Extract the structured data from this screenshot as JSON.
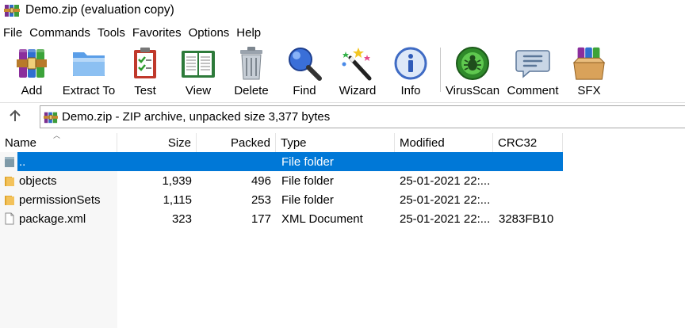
{
  "window": {
    "title": "Demo.zip (evaluation copy)"
  },
  "menu": [
    "File",
    "Commands",
    "Tools",
    "Favorites",
    "Options",
    "Help"
  ],
  "toolbar": [
    {
      "label": "Add",
      "icon": "add-archive-icon"
    },
    {
      "label": "Extract To",
      "icon": "extract-folder-icon"
    },
    {
      "label": "Test",
      "icon": "test-clipboard-icon"
    },
    {
      "label": "View",
      "icon": "view-book-icon"
    },
    {
      "label": "Delete",
      "icon": "trash-icon"
    },
    {
      "label": "Find",
      "icon": "magnifier-icon"
    },
    {
      "label": "Wizard",
      "icon": "magic-wand-icon"
    },
    {
      "label": "Info",
      "icon": "info-icon"
    },
    {
      "label": "VirusScan",
      "icon": "virus-scan-icon"
    },
    {
      "label": "Comment",
      "icon": "comment-icon"
    },
    {
      "label": "SFX",
      "icon": "sfx-box-icon"
    }
  ],
  "address": {
    "text": "Demo.zip - ZIP archive, unpacked size 3,377 bytes"
  },
  "columns": {
    "name": "Name",
    "size": "Size",
    "packed": "Packed",
    "type": "Type",
    "modified": "Modified",
    "crc": "CRC32"
  },
  "files": [
    {
      "name": "..",
      "size": "",
      "packed": "",
      "type": "File folder",
      "modified": "",
      "crc": "",
      "icon": "parent-folder-icon",
      "selected": true
    },
    {
      "name": "objects",
      "size": "1,939",
      "packed": "496",
      "type": "File folder",
      "modified": "25-01-2021 22:...",
      "crc": "",
      "icon": "folder-icon",
      "selected": false
    },
    {
      "name": "permissionSets",
      "size": "1,115",
      "packed": "253",
      "type": "File folder",
      "modified": "25-01-2021 22:...",
      "crc": "",
      "icon": "folder-icon",
      "selected": false
    },
    {
      "name": "package.xml",
      "size": "323",
      "packed": "177",
      "type": "XML Document",
      "modified": "25-01-2021 22:...",
      "crc": "3283FB10",
      "icon": "file-icon",
      "selected": false
    }
  ],
  "colors": {
    "selection": "#0078d7",
    "folder": "#f3c25b"
  }
}
